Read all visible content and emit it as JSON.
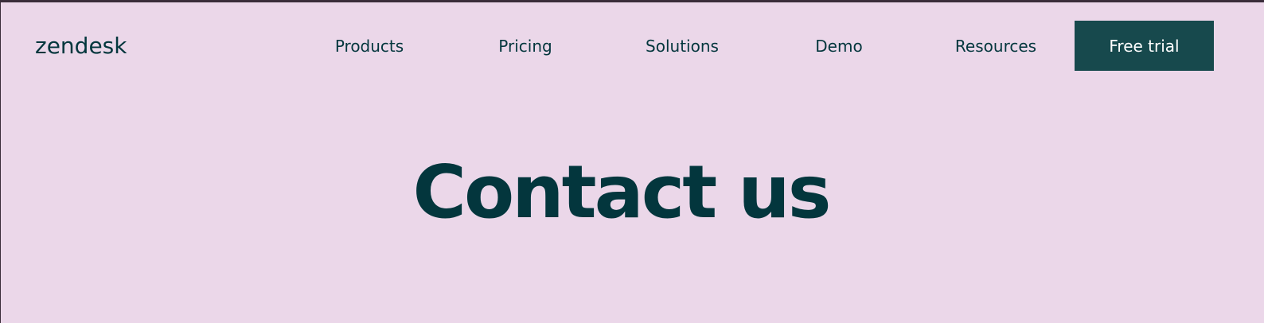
{
  "header": {
    "logo_text": "zendesk",
    "nav": [
      {
        "label": "Products"
      },
      {
        "label": "Pricing"
      },
      {
        "label": "Solutions"
      },
      {
        "label": "Demo"
      },
      {
        "label": "Resources"
      }
    ],
    "cta_label": "Free trial"
  },
  "hero": {
    "title": "Contact us"
  },
  "colors": {
    "background": "#ebd7e9",
    "text": "#03363d",
    "cta_background": "#17494d",
    "cta_text": "#ffffff"
  }
}
